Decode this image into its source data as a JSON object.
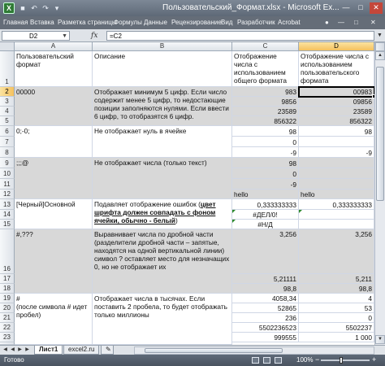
{
  "window": {
    "title": "Пользовательский_Формат.xlsx - Microsoft Ex...",
    "logo": "X",
    "quick_access": [
      "save-icon",
      "undo-icon",
      "redo-icon"
    ],
    "controls": [
      "minimize-icon",
      "maximize-icon",
      "close-icon"
    ]
  },
  "ribbon": {
    "tabs": [
      "Главная",
      "Вставка",
      "Разметка страницы",
      "Формулы",
      "Данные",
      "Рецензирование",
      "Вид",
      "Разработчик",
      "Acrobat"
    ]
  },
  "formula_bar": {
    "name_box": "D2",
    "fx": "fx",
    "formula": "=C2"
  },
  "columns": [
    "A",
    "B",
    "C",
    "D"
  ],
  "selected_column": "D",
  "selected_row": "2",
  "rows": [
    {
      "n": "1"
    },
    {
      "n": "2"
    },
    {
      "n": "3"
    },
    {
      "n": "4"
    },
    {
      "n": "5"
    },
    {
      "n": "6"
    },
    {
      "n": "7"
    },
    {
      "n": "8"
    },
    {
      "n": "9"
    },
    {
      "n": "10"
    },
    {
      "n": "11"
    },
    {
      "n": "12"
    },
    {
      "n": "13"
    },
    {
      "n": "14"
    },
    {
      "n": "15"
    },
    {
      "n": "16"
    },
    {
      "n": "17"
    },
    {
      "n": "18"
    },
    {
      "n": "19"
    },
    {
      "n": "20"
    },
    {
      "n": "21"
    },
    {
      "n": "22"
    },
    {
      "n": "23"
    },
    {
      "n": "24"
    }
  ],
  "header_row": {
    "a": "Пользовательский формат",
    "b": "Описание",
    "c": "Отображение числа с использованием общего формата",
    "d": "Отображение числа с использованием пользовательского формата"
  },
  "blocks": {
    "b1": {
      "a": "00000",
      "b": "Отображает минимум 5 цифр. Если число содержит менее 5 цифр, то недостающие позиции заполняются нулями. Если ввести 6 цифр, то отобразятся 6 цифр.",
      "c": [
        "983",
        "9856",
        "23589",
        "856322"
      ],
      "d": [
        "00983",
        "09856",
        "23589",
        "856322"
      ]
    },
    "b2": {
      "a": "0;-0;",
      "b": "Не отображает нуль в ячейке",
      "c": [
        "98",
        "0",
        "-9"
      ],
      "d": [
        "98",
        "",
        "-9"
      ]
    },
    "b3": {
      "a": ";;;@",
      "b": "Не отображает числа (только текст)",
      "c": [
        "98",
        "0",
        "-9",
        "hello"
      ],
      "d": [
        "",
        "",
        "",
        "hello"
      ]
    },
    "b4": {
      "a": "[Черный]Основной",
      "b_pre": "Подавляет отображение ошибок (",
      "b_bold": "цвет шрифта должен совпадать с фоном ячейки, обычно - белый",
      "b_post": ")",
      "c": [
        "0,333333333",
        "#ДЕЛ/0!",
        "#Н/Д"
      ],
      "d": [
        "0,333333333",
        "",
        ""
      ]
    },
    "b5": {
      "a": "#,???",
      "b": "Выравнивает числа по дробной части (разделители дробной части – запятые, находятся на одной вертикальной линии) символ ? оставляет место для незначащих 0, но не отображает их",
      "c": [
        "3,256",
        "5,21111",
        "98,8"
      ],
      "d": [
        "3,256",
        "5,211",
        "98,8"
      ]
    },
    "b6": {
      "a": "#\n(после символа # идет пробел)",
      "b": "Отображает числа в тысячах. Если поставить 2 пробела, то будет отображать только миллионы",
      "c": [
        "4058,34",
        "52865",
        "236",
        "5502236523",
        "999555"
      ],
      "d": [
        "4",
        "53",
        "0",
        "5502237",
        "1 000"
      ]
    }
  },
  "sheets": [
    "Лист1",
    "excel2.ru"
  ],
  "active_sheet": "Лист1",
  "status": {
    "ready": "Готово",
    "zoom": "100%",
    "zoom_minus": "−",
    "zoom_plus": "+"
  }
}
